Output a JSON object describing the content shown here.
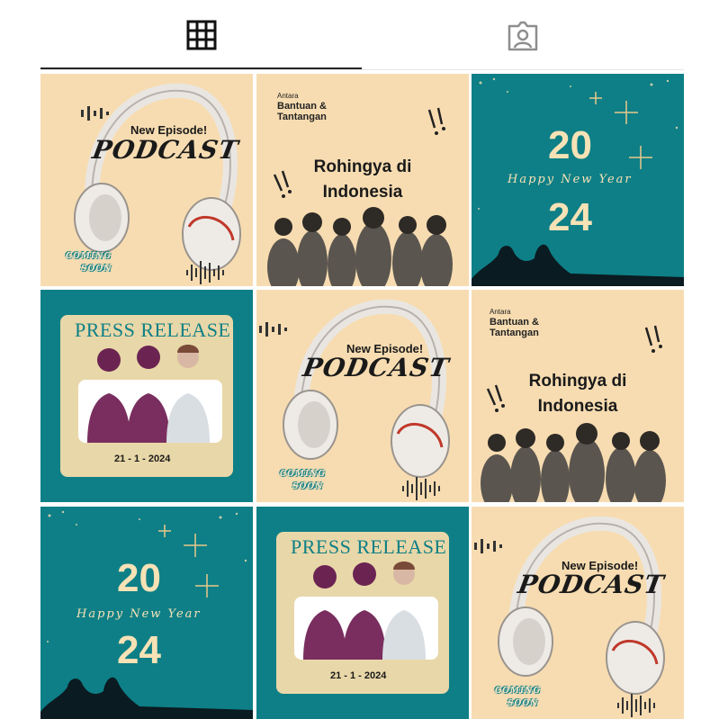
{
  "tabs": [
    {
      "label": "Posts",
      "icon": "grid-icon",
      "active": true
    },
    {
      "label": "Tagged",
      "icon": "tagged-person-icon",
      "active": false
    }
  ],
  "colors": {
    "teal": "#0e7f86",
    "beige": "#f7dcb1",
    "cream": "#f7e2b6",
    "card": "#e8d7a8"
  },
  "posts": {
    "podcast": {
      "headline": "New Episode!",
      "title": "PODCAST",
      "coming": [
        "COMING",
        "SOON"
      ]
    },
    "rohingya": {
      "antara": "Antara",
      "bantuan": [
        "Bantuan &",
        "Tantangan"
      ],
      "title": [
        "Rohingya di",
        "Indonesia"
      ]
    },
    "newyear": {
      "top": "20",
      "script": "Happy New Year",
      "bottom": "24"
    },
    "press": {
      "title": "PRESS RELEASE",
      "date": "21 - 1 - 2024"
    }
  }
}
